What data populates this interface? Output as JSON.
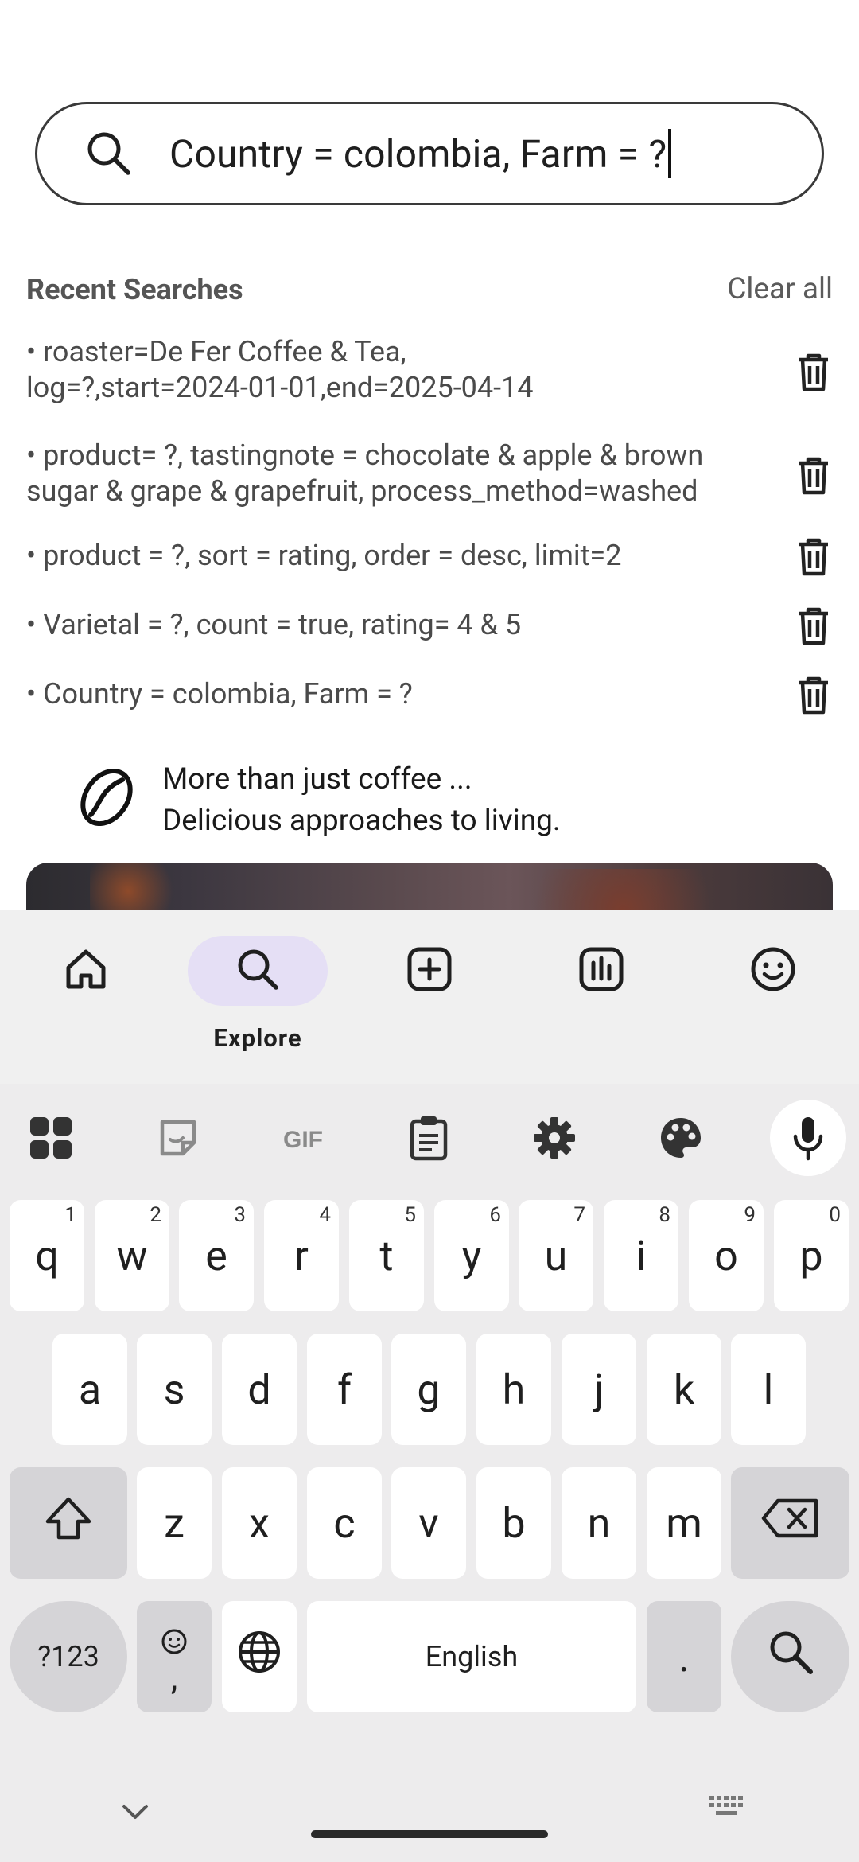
{
  "search": {
    "value": "Country = colombia, Farm = ?"
  },
  "recent": {
    "title": "Recent Searches",
    "clear_label": "Clear all",
    "items": [
      {
        "line1": "• roaster=De Fer Coffee & Tea,",
        "line2": "log=?,start=2024-01-01,end=2025-04-14"
      },
      {
        "line1": "• product= ?, tastingnote = chocolate & apple & brown",
        "line2": "sugar & grape & grapefruit, process_method=washed"
      },
      {
        "line1": "• product = ?, sort = rating, order = desc, limit=2",
        "line2": ""
      },
      {
        "line1": "• Varietal = ?, count = true, rating= 4 & 5",
        "line2": ""
      },
      {
        "line1": "• Country = colombia, Farm = ?",
        "line2": ""
      }
    ]
  },
  "promo": {
    "line1": "More than just coffee ...",
    "line2": "Delicious approaches to living."
  },
  "nav": {
    "items": [
      {
        "icon": "home-icon",
        "label": ""
      },
      {
        "icon": "search-icon",
        "label": "Explore"
      },
      {
        "icon": "add-box-icon",
        "label": ""
      },
      {
        "icon": "stats-icon",
        "label": ""
      },
      {
        "icon": "smiley-icon",
        "label": ""
      }
    ],
    "active_color": "#e5dff5"
  },
  "keyboard": {
    "row1": [
      {
        "k": "q",
        "h": "1"
      },
      {
        "k": "w",
        "h": "2"
      },
      {
        "k": "e",
        "h": "3"
      },
      {
        "k": "r",
        "h": "4"
      },
      {
        "k": "t",
        "h": "5"
      },
      {
        "k": "y",
        "h": "6"
      },
      {
        "k": "u",
        "h": "7"
      },
      {
        "k": "i",
        "h": "8"
      },
      {
        "k": "o",
        "h": "9"
      },
      {
        "k": "p",
        "h": "0"
      }
    ],
    "row2": [
      "a",
      "s",
      "d",
      "f",
      "g",
      "h",
      "j",
      "k",
      "l"
    ],
    "row3": [
      "z",
      "x",
      "c",
      "v",
      "b",
      "n",
      "m"
    ],
    "symbols_label": "?123",
    "comma_label": ",",
    "space_label": "English",
    "period_label": "."
  }
}
